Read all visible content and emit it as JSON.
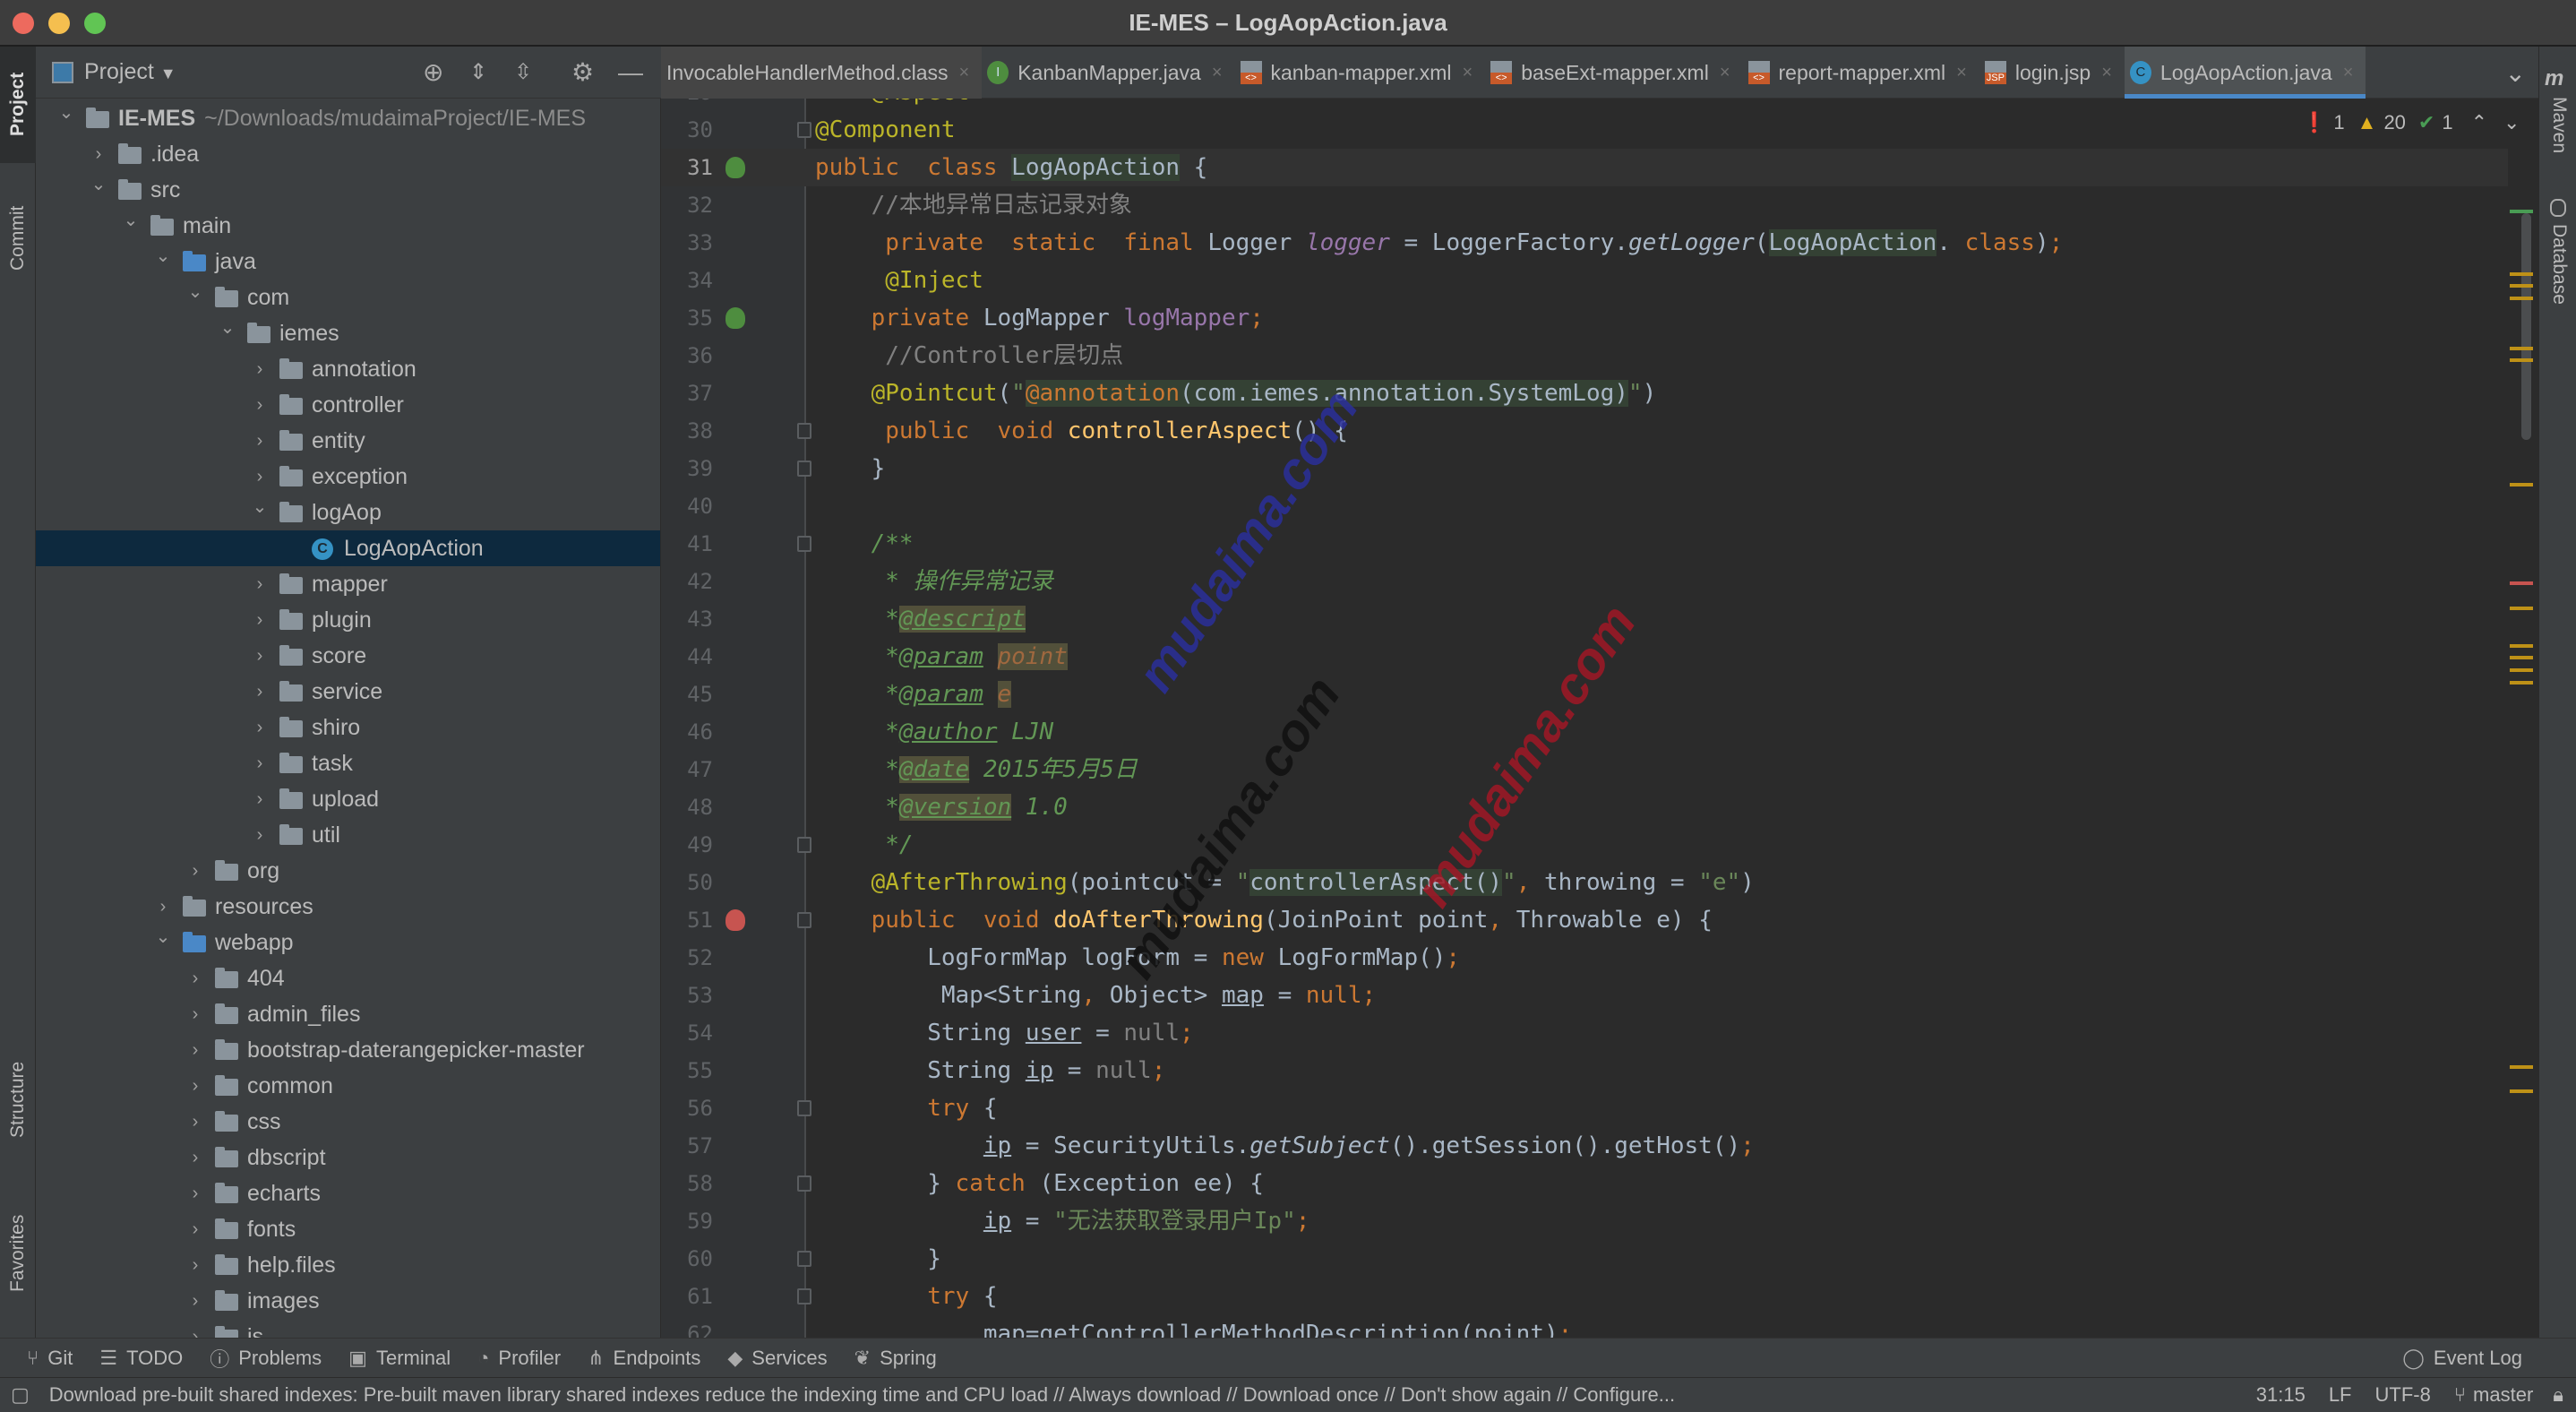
{
  "window": {
    "title": "IE-MES – LogAopAction.java"
  },
  "left_strip": [
    "Project",
    "Commit",
    "Structure",
    "Favorites"
  ],
  "right_strip": [
    "Maven",
    "Database"
  ],
  "project_panel": {
    "title": "Project",
    "tree": [
      {
        "label": "IE-MES",
        "path": "~/Downloads/mudaimaProject/IE-MES",
        "level": 0,
        "expanded": true,
        "icon": "module-folder"
      },
      {
        "label": ".idea",
        "level": 1,
        "expanded": false,
        "icon": "folder"
      },
      {
        "label": "src",
        "level": 1,
        "expanded": true,
        "icon": "folder"
      },
      {
        "label": "main",
        "level": 2,
        "expanded": true,
        "icon": "folder"
      },
      {
        "label": "java",
        "level": 3,
        "expanded": true,
        "icon": "source-folder"
      },
      {
        "label": "com",
        "level": 4,
        "expanded": true,
        "icon": "package"
      },
      {
        "label": "iemes",
        "level": 5,
        "expanded": true,
        "icon": "package"
      },
      {
        "label": "annotation",
        "level": 6,
        "expanded": false,
        "icon": "package"
      },
      {
        "label": "controller",
        "level": 6,
        "expanded": false,
        "icon": "package"
      },
      {
        "label": "entity",
        "level": 6,
        "expanded": false,
        "icon": "package"
      },
      {
        "label": "exception",
        "level": 6,
        "expanded": false,
        "icon": "package"
      },
      {
        "label": "logAop",
        "level": 6,
        "expanded": true,
        "icon": "package"
      },
      {
        "label": "LogAopAction",
        "level": 7,
        "icon": "class",
        "selected": true
      },
      {
        "label": "mapper",
        "level": 6,
        "expanded": false,
        "icon": "package"
      },
      {
        "label": "plugin",
        "level": 6,
        "expanded": false,
        "icon": "package"
      },
      {
        "label": "score",
        "level": 6,
        "expanded": false,
        "icon": "package"
      },
      {
        "label": "service",
        "level": 6,
        "expanded": false,
        "icon": "package"
      },
      {
        "label": "shiro",
        "level": 6,
        "expanded": false,
        "icon": "package"
      },
      {
        "label": "task",
        "level": 6,
        "expanded": false,
        "icon": "package"
      },
      {
        "label": "upload",
        "level": 6,
        "expanded": false,
        "icon": "package"
      },
      {
        "label": "util",
        "level": 6,
        "expanded": false,
        "icon": "package"
      },
      {
        "label": "org",
        "level": 4,
        "expanded": false,
        "icon": "package"
      },
      {
        "label": "resources",
        "level": 3,
        "expanded": false,
        "icon": "resources-folder"
      },
      {
        "label": "webapp",
        "level": 3,
        "expanded": true,
        "icon": "web-folder"
      },
      {
        "label": "404",
        "level": 4,
        "expanded": false,
        "icon": "folder"
      },
      {
        "label": "admin_files",
        "level": 4,
        "expanded": false,
        "icon": "folder"
      },
      {
        "label": "bootstrap-daterangepicker-master",
        "level": 4,
        "expanded": false,
        "icon": "folder"
      },
      {
        "label": "common",
        "level": 4,
        "expanded": false,
        "icon": "folder"
      },
      {
        "label": "css",
        "level": 4,
        "expanded": false,
        "icon": "folder"
      },
      {
        "label": "dbscript",
        "level": 4,
        "expanded": false,
        "icon": "folder"
      },
      {
        "label": "echarts",
        "level": 4,
        "expanded": false,
        "icon": "folder"
      },
      {
        "label": "fonts",
        "level": 4,
        "expanded": false,
        "icon": "folder"
      },
      {
        "label": "help.files",
        "level": 4,
        "expanded": false,
        "icon": "folder"
      },
      {
        "label": "images",
        "level": 4,
        "expanded": false,
        "icon": "folder"
      },
      {
        "label": "js",
        "level": 4,
        "expanded": false,
        "icon": "folder"
      }
    ]
  },
  "tabs": [
    {
      "label": "InvocableHandlerMethod.class",
      "icon": "none"
    },
    {
      "label": "KanbanMapper.java",
      "icon": "interface",
      "glyph": "I"
    },
    {
      "label": "kanban-mapper.xml",
      "icon": "xml",
      "glyph": "<>"
    },
    {
      "label": "baseExt-mapper.xml",
      "icon": "xml",
      "glyph": "<>"
    },
    {
      "label": "report-mapper.xml",
      "icon": "xml",
      "glyph": "<>"
    },
    {
      "label": "login.jsp",
      "icon": "jsp",
      "glyph": "JSP"
    },
    {
      "label": "LogAopAction.java",
      "icon": "class",
      "glyph": "C",
      "active": true
    }
  ],
  "inspections": {
    "errors": "1",
    "warnings": "20",
    "ok": "1"
  },
  "editor": {
    "current_line": 31,
    "first_line": 29,
    "lines": [
      {
        "n": "29",
        "t": [
          [
            "    ",
            ""
          ],
          [
            "@Aspect",
            "ann"
          ]
        ]
      },
      {
        "n": "30",
        "t": [
          [
            "@Component",
            "ann"
          ]
        ],
        "fold": true
      },
      {
        "n": "31",
        "t": [
          [
            "public",
            "kw"
          ],
          [
            "  ",
            ""
          ],
          [
            "class",
            "kw"
          ],
          [
            " ",
            ""
          ],
          [
            "LogAopAction",
            "hl"
          ],
          [
            " {",
            ""
          ]
        ],
        "gicon": "bean-icon"
      },
      {
        "n": "32",
        "t": [
          [
            "    //本地异常日志记录对象",
            "cmt"
          ]
        ]
      },
      {
        "n": "33",
        "t": [
          [
            "     ",
            ""
          ],
          [
            "private",
            "kw"
          ],
          [
            "  ",
            ""
          ],
          [
            "static",
            "kw"
          ],
          [
            "  ",
            ""
          ],
          [
            "final",
            "kw"
          ],
          [
            " Logger ",
            ""
          ],
          [
            "logger",
            "fld ital"
          ],
          [
            " = LoggerFactory.",
            ""
          ],
          [
            "getLogger",
            "ital"
          ],
          [
            "(",
            ""
          ],
          [
            "LogAopAction",
            "hl"
          ],
          [
            ". ",
            ""
          ],
          [
            "class",
            "kw"
          ],
          [
            ")",
            ""
          ],
          [
            ";",
            "kw"
          ]
        ]
      },
      {
        "n": "34",
        "t": [
          [
            "     ",
            ""
          ],
          [
            "@Inject",
            "ann"
          ]
        ]
      },
      {
        "n": "35",
        "t": [
          [
            "    ",
            ""
          ],
          [
            "private",
            "kw"
          ],
          [
            " LogMapper ",
            ""
          ],
          [
            "logMapper",
            "fld"
          ],
          [
            ";",
            "kw"
          ]
        ],
        "gicon": "injection-icon"
      },
      {
        "n": "36",
        "t": [
          [
            "     //Controller层切点",
            "cmt"
          ]
        ]
      },
      {
        "n": "37",
        "t": [
          [
            "    ",
            ""
          ],
          [
            "@Pointcut",
            "ann"
          ],
          [
            "(",
            ""
          ],
          [
            "\"",
            "str"
          ],
          [
            "@annotation",
            "kw hl"
          ],
          [
            "(com.iemes.annotation.SystemLog)",
            "hl"
          ],
          [
            "\"",
            "str"
          ],
          [
            ")",
            ""
          ]
        ]
      },
      {
        "n": "38",
        "t": [
          [
            "     ",
            ""
          ],
          [
            "public",
            "kw"
          ],
          [
            "  ",
            ""
          ],
          [
            "void",
            "kw"
          ],
          [
            " ",
            ""
          ],
          [
            "controllerAspect",
            "mth"
          ],
          [
            "() {",
            ""
          ]
        ],
        "fold": true
      },
      {
        "n": "39",
        "t": [
          [
            "    }",
            ""
          ]
        ],
        "fold": true
      },
      {
        "n": "40",
        "t": []
      },
      {
        "n": "41",
        "t": [
          [
            "    /**",
            "doc"
          ]
        ],
        "fold": true
      },
      {
        "n": "42",
        "t": [
          [
            "     * 操作异常记录",
            "doc"
          ]
        ]
      },
      {
        "n": "43",
        "t": [
          [
            "     *",
            "doc"
          ],
          [
            "@descript",
            "dtag dhl"
          ]
        ]
      },
      {
        "n": "44",
        "t": [
          [
            "     *",
            "doc"
          ],
          [
            "@param",
            "dtag"
          ],
          [
            " ",
            ""
          ],
          [
            "point",
            "ptag"
          ]
        ]
      },
      {
        "n": "45",
        "t": [
          [
            "     *",
            "doc"
          ],
          [
            "@param",
            "dtag"
          ],
          [
            " ",
            ""
          ],
          [
            "e",
            "ptag"
          ]
        ]
      },
      {
        "n": "46",
        "t": [
          [
            "     *",
            "doc"
          ],
          [
            "@author",
            "dtag"
          ],
          [
            " LJN",
            "doc"
          ]
        ]
      },
      {
        "n": "47",
        "t": [
          [
            "     *",
            "doc"
          ],
          [
            "@date",
            "dtag dhl"
          ],
          [
            " 2015年5月5日",
            "doc"
          ]
        ]
      },
      {
        "n": "48",
        "t": [
          [
            "     *",
            "doc"
          ],
          [
            "@version",
            "dtag dhl"
          ],
          [
            " 1.0",
            "doc"
          ]
        ]
      },
      {
        "n": "49",
        "t": [
          [
            "     */",
            "doc"
          ]
        ],
        "fold": true
      },
      {
        "n": "50",
        "t": [
          [
            "    ",
            ""
          ],
          [
            "@AfterThrowing",
            "ann"
          ],
          [
            "(pointcut = ",
            ""
          ],
          [
            "\"",
            "str"
          ],
          [
            "controllerAspect()",
            "hl"
          ],
          [
            "\"",
            "str"
          ],
          [
            ", ",
            "kw"
          ],
          [
            "throwing = ",
            ""
          ],
          [
            "\"e\"",
            "str"
          ],
          [
            ")",
            ""
          ]
        ]
      },
      {
        "n": "51",
        "t": [
          [
            "    ",
            ""
          ],
          [
            "public",
            "kw"
          ],
          [
            "  ",
            ""
          ],
          [
            "void",
            "kw"
          ],
          [
            " ",
            ""
          ],
          [
            "doAfterThrowing",
            "mth"
          ],
          [
            "(JoinPoint point",
            ""
          ],
          [
            ", ",
            "kw"
          ],
          [
            "Throwable e) {",
            ""
          ]
        ],
        "fold": true,
        "gicon": "aspect-advice-icon"
      },
      {
        "n": "52",
        "t": [
          [
            "        LogFormMap logForm = ",
            ""
          ],
          [
            "new",
            "kw"
          ],
          [
            " LogFormMap()",
            ""
          ],
          [
            ";",
            "kw"
          ]
        ]
      },
      {
        "n": "53",
        "t": [
          [
            "         Map<String",
            ""
          ],
          [
            ", ",
            "kw"
          ],
          [
            "Object> ",
            ""
          ],
          [
            "map",
            "ul"
          ],
          [
            " = ",
            ""
          ],
          [
            "null",
            "kw"
          ],
          [
            ";",
            "kw"
          ]
        ]
      },
      {
        "n": "54",
        "t": [
          [
            "        String ",
            ""
          ],
          [
            "user",
            "ul"
          ],
          [
            " = ",
            ""
          ],
          [
            "null",
            "gray"
          ],
          [
            ";",
            "kw"
          ]
        ]
      },
      {
        "n": "55",
        "t": [
          [
            "        String ",
            ""
          ],
          [
            "ip",
            "ul"
          ],
          [
            " = ",
            ""
          ],
          [
            "null",
            "gray"
          ],
          [
            ";",
            "kw"
          ]
        ]
      },
      {
        "n": "56",
        "t": [
          [
            "        ",
            ""
          ],
          [
            "try",
            "kw"
          ],
          [
            " {",
            ""
          ]
        ],
        "fold": true
      },
      {
        "n": "57",
        "t": [
          [
            "            ",
            ""
          ],
          [
            "ip",
            "ul"
          ],
          [
            " = SecurityUtils.",
            ""
          ],
          [
            "getSubject",
            "ital"
          ],
          [
            "().getSession().getHost()",
            ""
          ],
          [
            ";",
            "kw"
          ]
        ]
      },
      {
        "n": "58",
        "t": [
          [
            "        } ",
            ""
          ],
          [
            "catch",
            "kw"
          ],
          [
            " (Exception ee) {",
            ""
          ]
        ],
        "fold": true
      },
      {
        "n": "59",
        "t": [
          [
            "            ",
            ""
          ],
          [
            "ip",
            "ul"
          ],
          [
            " = ",
            ""
          ],
          [
            "\"无法获取登录用户Ip\"",
            "str"
          ],
          [
            ";",
            "kw"
          ]
        ]
      },
      {
        "n": "60",
        "t": [
          [
            "        }",
            ""
          ]
        ],
        "fold": true
      },
      {
        "n": "61",
        "t": [
          [
            "        ",
            ""
          ],
          [
            "try",
            "kw"
          ],
          [
            " {",
            ""
          ]
        ],
        "fold": true
      },
      {
        "n": "62",
        "t": [
          [
            "            map=getControllerMethodDescription(point)",
            ""
          ],
          [
            ";",
            "kw"
          ]
        ]
      }
    ]
  },
  "error_stripe": [
    {
      "line_fraction": 0.09,
      "color": "#499c54"
    },
    {
      "line_fraction": 0.14,
      "color": "#be9117"
    },
    {
      "line_fraction": 0.15,
      "color": "#be9117"
    },
    {
      "line_fraction": 0.16,
      "color": "#be9117"
    },
    {
      "line_fraction": 0.2,
      "color": "#be9117"
    },
    {
      "line_fraction": 0.21,
      "color": "#be9117"
    },
    {
      "line_fraction": 0.31,
      "color": "#be9117"
    },
    {
      "line_fraction": 0.39,
      "color": "#c75450"
    },
    {
      "line_fraction": 0.41,
      "color": "#be9117"
    },
    {
      "line_fraction": 0.44,
      "color": "#be9117"
    },
    {
      "line_fraction": 0.45,
      "color": "#be9117"
    },
    {
      "line_fraction": 0.46,
      "color": "#be9117"
    },
    {
      "line_fraction": 0.47,
      "color": "#be9117"
    },
    {
      "line_fraction": 0.78,
      "color": "#be9117"
    },
    {
      "line_fraction": 0.8,
      "color": "#be9117"
    }
  ],
  "watermarks": [
    "mudaima.com",
    "mudaima.com",
    "mudaima.com"
  ],
  "tool_windows": [
    "Git",
    "TODO",
    "Problems",
    "Terminal",
    "Profiler",
    "Endpoints",
    "Services",
    "Spring"
  ],
  "event_log": "Event Log",
  "status": {
    "message": "Download pre-built shared indexes: Pre-built maven library shared indexes reduce the indexing time and CPU load // Always download // Download once // Don't show again // Configure...",
    "position": "31:15",
    "line_separator": "LF",
    "encoding": "UTF-8",
    "branch": "master"
  }
}
